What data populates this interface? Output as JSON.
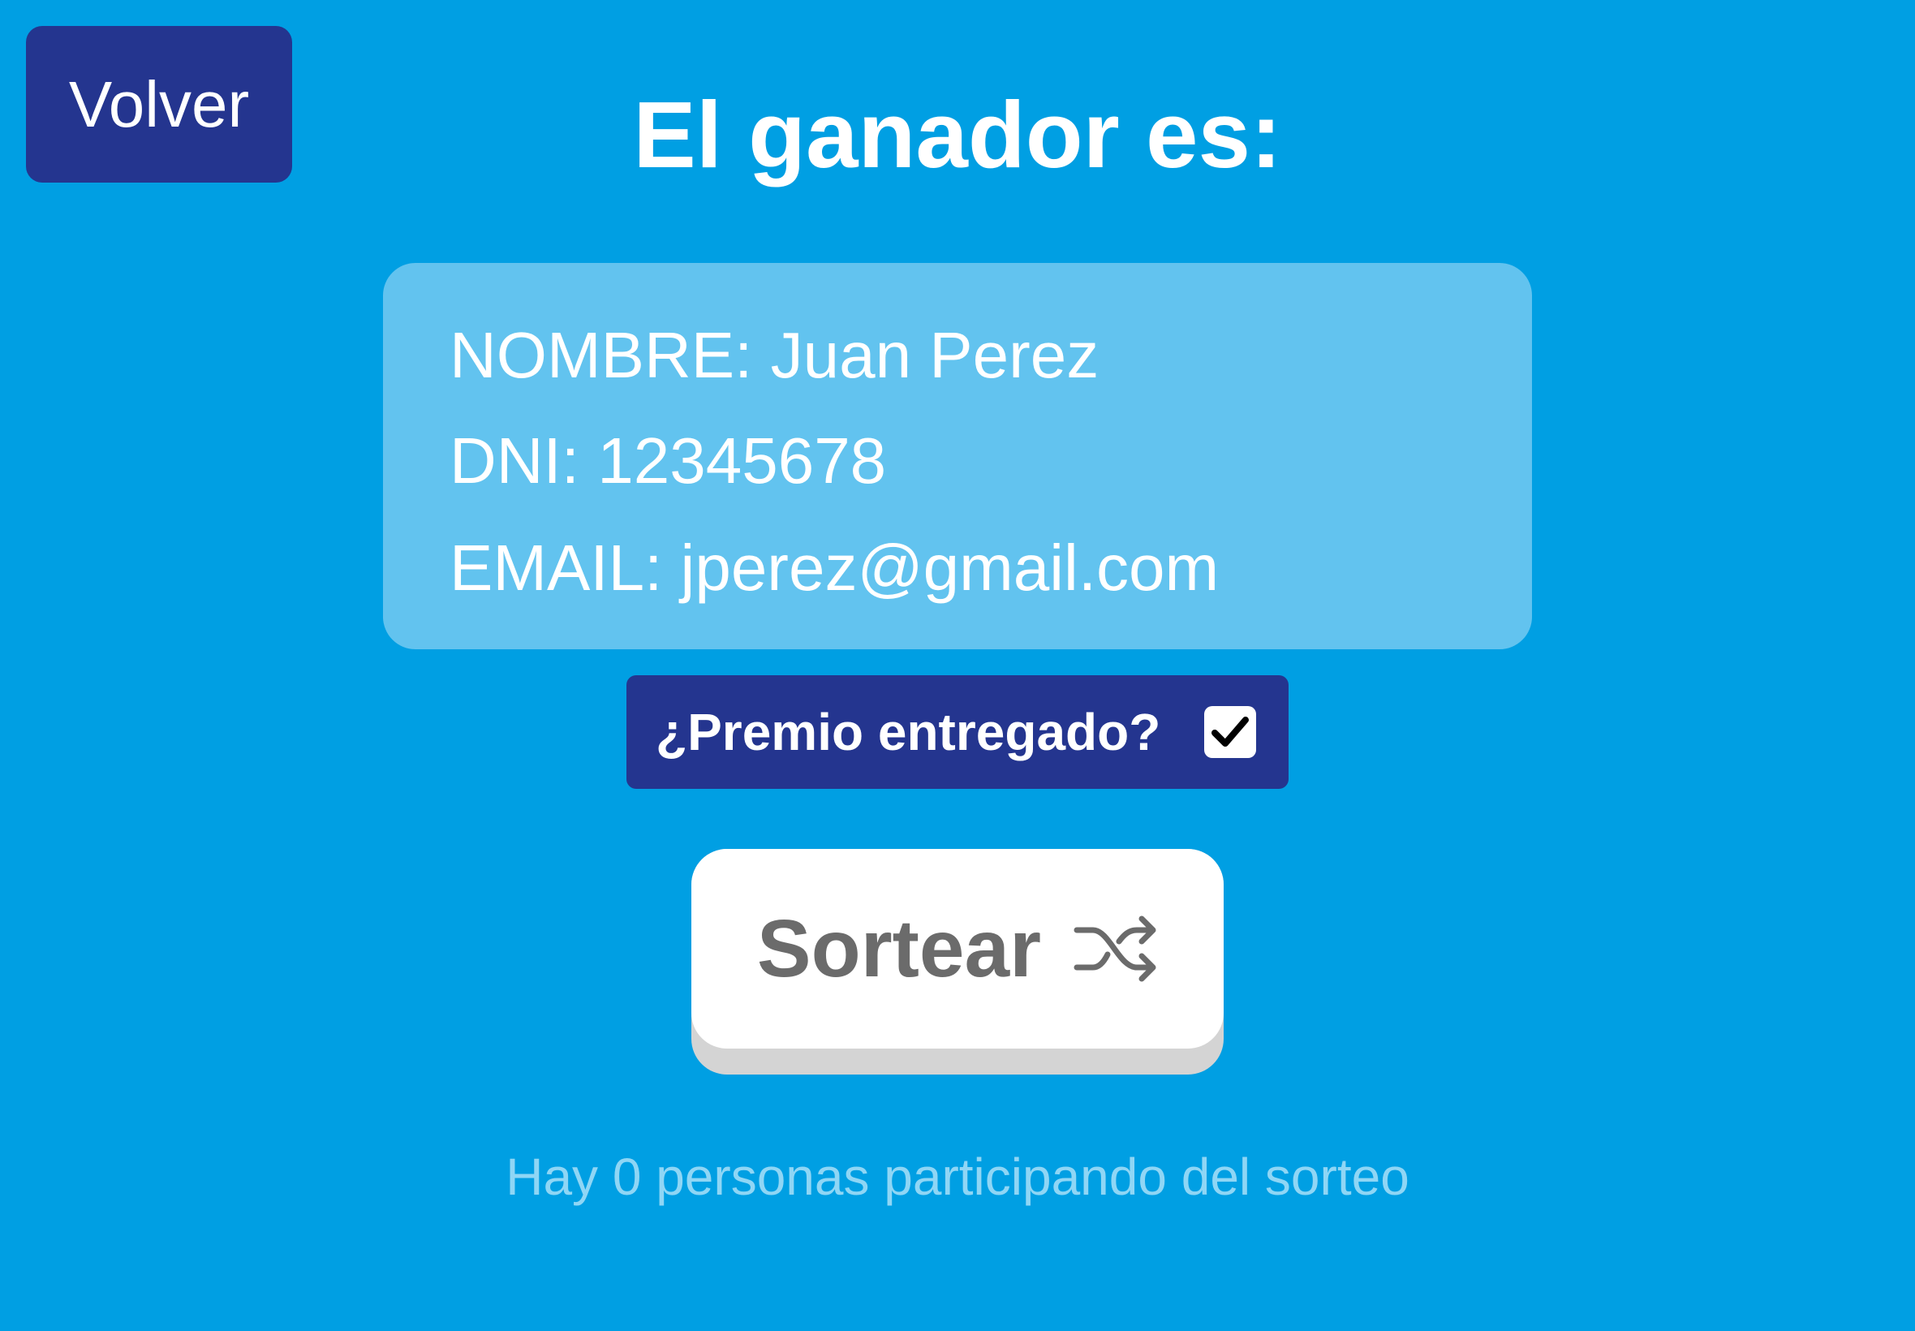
{
  "header": {
    "back_label": "Volver",
    "title": "El ganador es:"
  },
  "winner": {
    "name_label": "NOMBRE:",
    "name_value": "Juan Perez",
    "dni_label": "DNI:",
    "dni_value": "12345678",
    "email_label": "EMAIL:",
    "email_value": "jperez@gmail.com"
  },
  "prize": {
    "label": "¿Premio entregado?",
    "checked": true
  },
  "draw": {
    "label": "Sortear",
    "icon": "shuffle-icon"
  },
  "footer": {
    "participants_text": "Hay 0 personas participando del sorteo"
  },
  "colors": {
    "background": "#009fe3",
    "dark_blue": "#24358f",
    "card": "#62c3ef",
    "button_text": "#6b6b6b",
    "participants_text": "#8fd6f5"
  }
}
